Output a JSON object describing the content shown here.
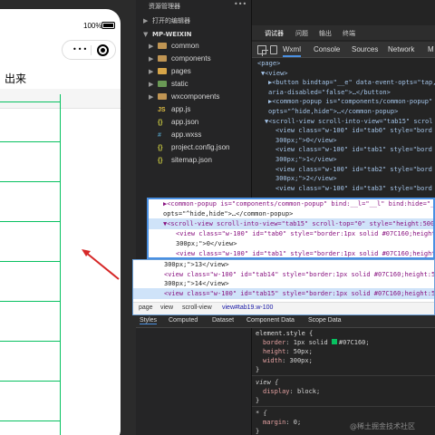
{
  "simulator": {
    "battery_percent": "100%",
    "capsule_dots": "•••",
    "page_text": "出来"
  },
  "explorer": {
    "title": "资源管理器",
    "more": "•••",
    "open_editors": "打开的编辑器",
    "project": "MP-WEIXIN",
    "items": [
      {
        "label": "common",
        "type": "folder"
      },
      {
        "label": "components",
        "type": "folder"
      },
      {
        "label": "pages",
        "type": "folder"
      },
      {
        "label": "static",
        "type": "folder"
      },
      {
        "label": "wxcomponents",
        "type": "folder"
      },
      {
        "label": "app.js",
        "type": "js",
        "icon": "JS"
      },
      {
        "label": "app.json",
        "type": "json",
        "icon": "{}"
      },
      {
        "label": "app.wxss",
        "type": "css",
        "icon": "#"
      },
      {
        "label": "project.config.json",
        "type": "json",
        "icon": "{}"
      },
      {
        "label": "sitemap.json",
        "type": "json",
        "icon": "{}"
      }
    ]
  },
  "devtools": {
    "top_tabs": [
      "调试器",
      "问题",
      "输出",
      "终端"
    ],
    "sub_tabs": [
      "Wxml",
      "Console",
      "Sources",
      "Network",
      "M"
    ],
    "dom_lines": [
      "<page>",
      "▼<view>",
      "▶<button bindtap=\"__e\" data-event-opts=\"tap,",
      "aria-disabled=\"false\">…</button>",
      "▶<common-popup is=\"components/common-popup\"",
      "opts=\"^hide,hide\">…</common-popup>",
      "▼<scroll-view scroll-into-view=\"tab15\" scrol",
      "<view class=\"w-100\" id=\"tab0\" style=\"bord",
      "300px;\">0</view>",
      "<view class=\"w-100\" id=\"tab1\" style=\"bord",
      "300px;\">1</view>",
      "<view class=\"w-100\" id=\"tab2\" style=\"bord",
      "300px;\">2</view>",
      "<view class=\"w-100\" id=\"tab3\" style=\"bord"
    ],
    "overlay_lines": [
      "▶<common-popup is=\"components/common-popup\" bind:__l=\"__l\" bind:hide=\"__e\"",
      "opts=\"^hide,hide\">…</common-popup>",
      "▼<scroll-view scroll-into-view=\"tab15\" scroll-top=\"0\" style=\"height:500p",
      "<view class=\"w-100\" id=\"tab0\" style=\"border:1px solid #07C160;height:5",
      "300px;\">0</view>",
      "<view class=\"w-100\" id=\"tab1\" style=\"border:1px solid #07C160;height:5"
    ],
    "overlay2_lines": [
      "300px;\">13</view>",
      "<view class=\"w-100\" id=\"tab14\" style=\"border:1px solid #07C160;height:50",
      "300px;\">14</view>",
      "<view class=\"w-100\" id=\"tab15\" style=\"border:1px solid #07C160;height:50"
    ],
    "breadcrumbs": [
      "page",
      "view",
      "scroll-view",
      "view#tab19.w-100"
    ],
    "styles_tabs": [
      "Styles",
      "Computed",
      "Dataset",
      "Component Data",
      "Scope Data"
    ],
    "styles": {
      "element_style": "element.style {",
      "border": "1px solid",
      "border_color": "#07C160;",
      "height": "50px;",
      "width": "300px;",
      "close": "}",
      "view_sel": "view {",
      "display": "block;",
      "star_sel": "* {",
      "margin": "0;"
    }
  },
  "watermark": "@稀土掘金技术社区",
  "colors": {
    "accent_green": "#07c160",
    "arrow_red": "#d62828",
    "selection_blue": "#4a90e2"
  }
}
